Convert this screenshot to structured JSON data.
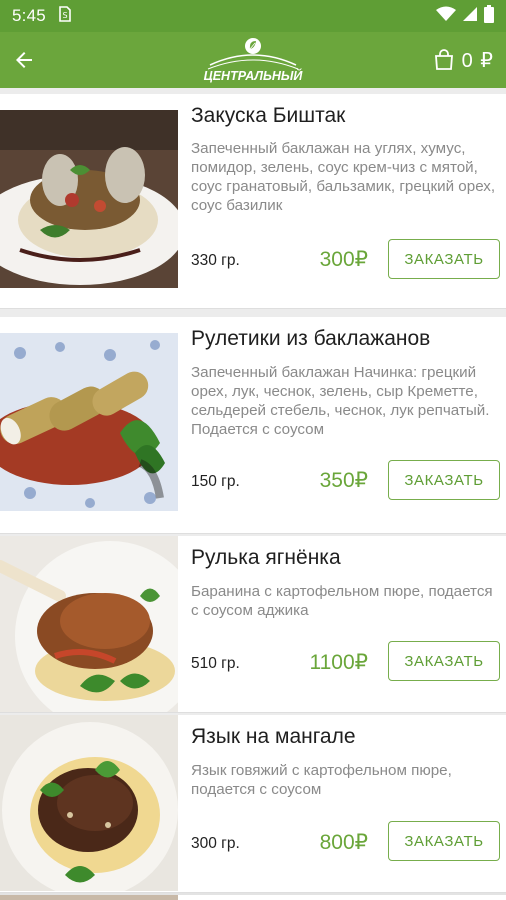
{
  "status_bar": {
    "time": "5:45"
  },
  "app_bar": {
    "logo_text": "ЦЕНТРАЛЬНЫЙ",
    "cart_count": "0 ₽"
  },
  "items": [
    {
      "title": "Закуска Биштак",
      "description": "Запеченный баклажан на углях, хумус, помидор, зелень, соус крем-чиз с мятой, соус  гранатовый, бальзамик, грецкий орех, соус базилик",
      "weight": "330 гр.",
      "price": "300₽",
      "button": "ЗАКАЗАТЬ"
    },
    {
      "title": "Рулетики из баклажанов",
      "description": "Запеченный баклажан Начинка: грецкий орех, лук, чеснок, зелень, сыр Креметте, сельдерей стебель, чеснок, лук репчатый. Подается с соусом",
      "weight": "150 гр.",
      "price": "350₽",
      "button": "ЗАКАЗАТЬ"
    },
    {
      "title": "Рулька ягнёнка",
      "description": "Баранина с картофельном пюре, подается с соусом аджика",
      "weight": "510 гр.",
      "price": "1100₽",
      "button": "ЗАКАЗАТЬ"
    },
    {
      "title": "Язык на мангале",
      "description": "Язык говяжий с картофельном пюре, подается с соусом",
      "weight": "300 гр.",
      "price": "800₽",
      "button": "ЗАКАЗАТЬ"
    }
  ]
}
